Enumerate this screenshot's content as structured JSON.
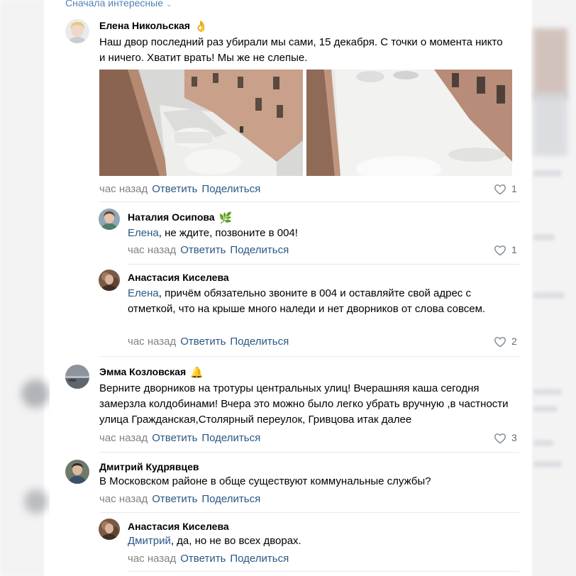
{
  "sort": {
    "label": "Сначала интересные"
  },
  "comments": [
    {
      "author": "Елена Никольская",
      "emoji": "👌",
      "text": "Наш двор последний раз убирали мы сами, 15 декабря. С точки о момента никто и ничего. Хватит врать! Мы же не слепые.",
      "time": "час назад",
      "reply": "Ответить",
      "share": "Поделиться",
      "likes": "1"
    },
    {
      "author": "Наталия Осипова",
      "emoji": "🌿",
      "mention": "Елена",
      "text": ", не ждите, позвоните в 004!",
      "time": "час назад",
      "reply": "Ответить",
      "share": "Поделиться",
      "likes": "1"
    },
    {
      "author": "Анастасия Киселева",
      "mention": "Елена",
      "text": ", причём обязательно звоните в 004 и оставляйте свой адрес с отметкой, что на крыше много наледи и нет дворников от слова совсем.",
      "time": "час назад",
      "reply": "Ответить",
      "share": "Поделиться",
      "likes": "2"
    },
    {
      "author": "Эмма Козловская",
      "emoji": "🔔",
      "text": "Верните дворников на тротуры центральных улиц! Вчерашняя каша сегодня замерзла колдобинами! Вчера это можно было легко убрать вручную ,в частности улица Гражданская,Столярный переулок, Гривцова итак далее",
      "time": "час назад",
      "reply": "Ответить",
      "share": "Поделиться",
      "likes": "3"
    },
    {
      "author": "Дмитрий Кудрявцев",
      "text": "В Московском районе в обще существуют коммунальные службы?",
      "time": "час назад",
      "reply": "Ответить",
      "share": "Поделиться"
    },
    {
      "author": "Анастасия Киселева",
      "mention": "Дмитрий",
      "text": ", да, но не во всех дворах.",
      "time": "час назад",
      "reply": "Ответить",
      "share": "Поделиться"
    }
  ],
  "colors": {
    "link": "#2a5885",
    "meta": "#828282",
    "divider": "#e7e8ec"
  }
}
